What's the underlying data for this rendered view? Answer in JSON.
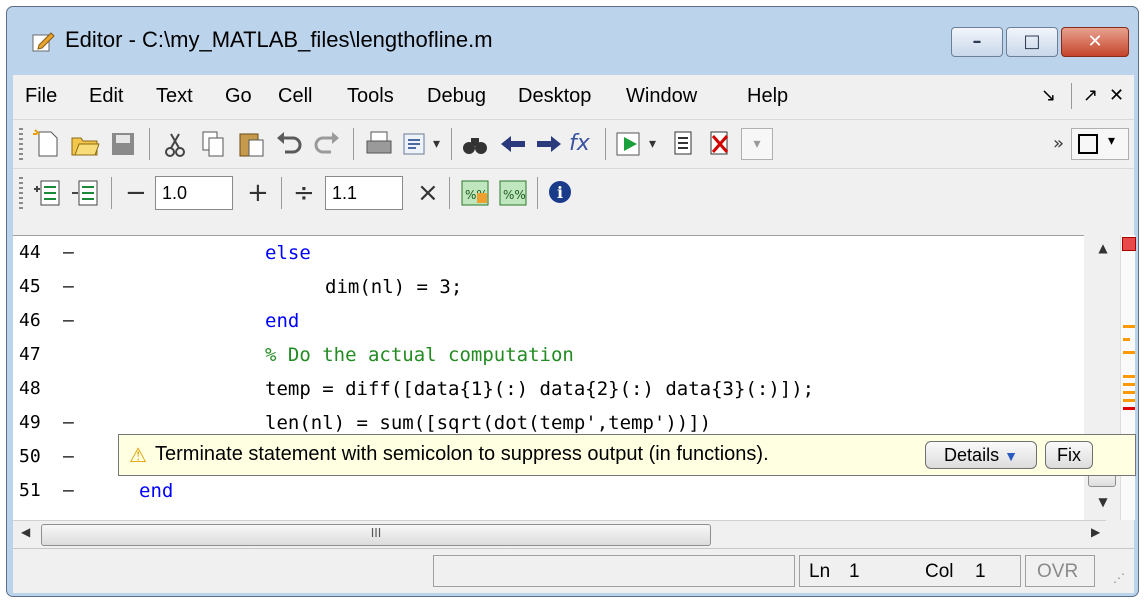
{
  "window": {
    "title": "Editor - C:\\my_MATLAB_files\\lengthofline.m",
    "min_glyph": "–",
    "max_glyph": "□",
    "close_glyph": "✕"
  },
  "menu": {
    "items": [
      "File",
      "Edit",
      "Text",
      "Go",
      "Cell",
      "Tools",
      "Debug",
      "Desktop",
      "Window",
      "Help"
    ],
    "dock_glyph": "↘",
    "undock_glyph": "↗",
    "close_glyph": "✕"
  },
  "toolbar2": {
    "cell_divide": "1.0",
    "cell_increment": "1.1",
    "minus": "−",
    "plus": "+",
    "divide": "÷",
    "times": "×"
  },
  "code_lines": [
    {
      "n": "44",
      "dash": "–",
      "text": "else"
    },
    {
      "n": "45",
      "dash": "–",
      "text": "dim(nl) = 3;"
    },
    {
      "n": "46",
      "dash": "–",
      "text": "end"
    },
    {
      "n": "47",
      "dash": "",
      "text": "% Do the actual computation"
    },
    {
      "n": "48",
      "dash": "",
      "text": "temp = diff([data{1}(:) data{2}(:) data{3}(:)]);"
    },
    {
      "n": "49",
      "dash": "–",
      "text": "len(nl) = sum([sqrt(dot(temp',temp'))])"
    },
    {
      "n": "50",
      "dash": "–",
      "text": ""
    },
    {
      "n": "51",
      "dash": "–",
      "text": "end"
    }
  ],
  "tooltip": {
    "message": "Terminate statement with semicolon to suppress output (in functions).",
    "details_label": "Details",
    "fix_label": "Fix"
  },
  "status": {
    "ln_label": "Ln",
    "ln_value": "1",
    "col_label": "Col",
    "col_value": "1",
    "mode": "OVR"
  },
  "colors": {
    "keyword": "#0000ff",
    "comment": "#228b22",
    "warning_marker": "#ff9900",
    "error_marker": "#e00000",
    "tooltip_bg": "#ffffe1"
  },
  "scroll": {
    "thumb_glyph": "III"
  }
}
